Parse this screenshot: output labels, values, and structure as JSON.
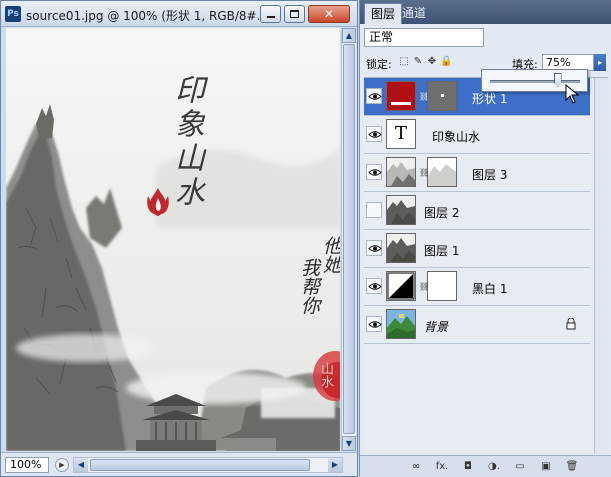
{
  "document": {
    "title": "source01.jpg @ 100% (形状 1, RGB/8#...",
    "app_logo": "Ps",
    "zoom": "100%",
    "window_buttons": {
      "minimize": "minimize-icon",
      "maximize": "maximize-icon",
      "close": "✕"
    },
    "canvas_texts": {
      "vertical_title": "印象山水",
      "poem_line_1": "他她",
      "poem_line_2": "我帮你",
      "seal_text": "山水"
    }
  },
  "panel": {
    "tabs": [
      "图层",
      "通道"
    ],
    "blend_mode": "正常",
    "lock_label": "锁定:",
    "fill_label": "填充:",
    "fill_value": "75%",
    "fill_slider_value": 75,
    "fill_arrow": "▸",
    "layers": [
      {
        "name": "形状 1",
        "visible": true,
        "selected": true,
        "type": "shape",
        "italic": false,
        "locked": false
      },
      {
        "name": "印象山水",
        "visible": true,
        "selected": false,
        "type": "text",
        "italic": false,
        "locked": false,
        "thumb_glyph": "T"
      },
      {
        "name": "图层 3",
        "visible": true,
        "selected": false,
        "type": "masked-image",
        "italic": false,
        "locked": false
      },
      {
        "name": "图层 2",
        "visible": false,
        "selected": false,
        "type": "image",
        "italic": false,
        "locked": false
      },
      {
        "name": "图层 1",
        "visible": true,
        "selected": false,
        "type": "image",
        "italic": false,
        "locked": false
      },
      {
        "name": "黑白 1",
        "visible": true,
        "selected": false,
        "type": "adjustment",
        "italic": false,
        "locked": false
      },
      {
        "name": "背景",
        "visible": true,
        "selected": false,
        "type": "background",
        "italic": true,
        "locked": true
      }
    ],
    "footer_icons": [
      "link-icon",
      "fx-icon",
      "mask-icon",
      "adjustment-icon",
      "folder-icon",
      "new-layer-icon",
      "trash-icon"
    ],
    "footer_labels": [
      "∞",
      "fx.",
      "◘",
      "◑.",
      "▭",
      "▣",
      "🗑"
    ]
  },
  "colors": {
    "selection": "#3d6fc8",
    "shape_red": "#b01014"
  }
}
